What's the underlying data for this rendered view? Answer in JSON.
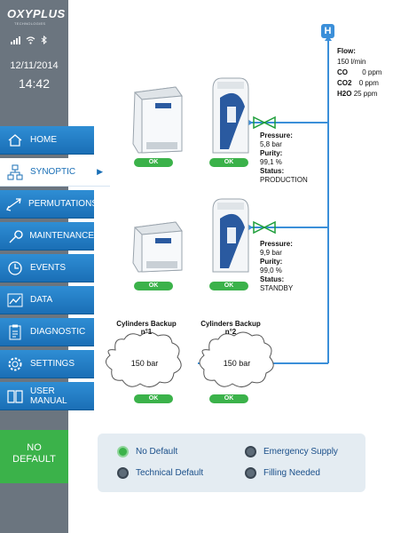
{
  "brand": {
    "name": "OXYPLUS",
    "subtitle": "TECHNOLOGIES"
  },
  "status": {
    "date": "12/11/2014",
    "time": "14:42"
  },
  "nav": [
    {
      "id": "home",
      "label": "HOME",
      "icon": "home-icon"
    },
    {
      "id": "synoptic",
      "label": "SYNOPTIC",
      "icon": "network-icon",
      "active": true
    },
    {
      "id": "permutations",
      "label": "PERMUTATIONS",
      "icon": "swap-arrows-icon"
    },
    {
      "id": "maintenance",
      "label": "MAINTENANCE",
      "icon": "wrench-icon"
    },
    {
      "id": "events",
      "label": "EVENTS",
      "icon": "history-clock-icon"
    },
    {
      "id": "data",
      "label": "DATA",
      "icon": "chart-icon"
    },
    {
      "id": "diagnostic",
      "label": "DIAGNOSTIC",
      "icon": "clipboard-icon"
    },
    {
      "id": "settings",
      "label": "SETTINGS",
      "icon": "gear-icon"
    },
    {
      "id": "user_manual",
      "label": "USER MANUAL",
      "icon": "book-icon"
    }
  ],
  "system_state": {
    "line1": "NO",
    "line2": "DEFAULT",
    "color": "#3bb24a"
  },
  "lines": [
    {
      "compressor_status": "OK",
      "generator_status": "OK",
      "pressure_label": "Pressure:",
      "pressure": "5,8 bar",
      "purity_label": "Purity:",
      "purity": "99,1 %",
      "status_label": "Status:",
      "status": "PRODUCTION"
    },
    {
      "compressor_status": "OK",
      "generator_status": "OK",
      "pressure_label": "Pressure:",
      "pressure": "9,9 bar",
      "purity_label": "Purity:",
      "purity": "99,0 %",
      "status_label": "Status:",
      "status": "STANDBY"
    }
  ],
  "cylinders": [
    {
      "title_line1": "Cylinders Backup",
      "title_line2": "n°1",
      "pressure": "150 bar",
      "status": "OK"
    },
    {
      "title_line1": "Cylinders Backup",
      "title_line2": "n°2",
      "pressure": "150 bar",
      "status": "OK"
    }
  ],
  "output": {
    "gas_symbol": "H",
    "flow_label": "Flow:",
    "flow_value": "150 l/min",
    "co_label": "CO",
    "co_value": "0 ppm",
    "co2_label": "CO2",
    "co2_value": "0 ppm",
    "h2o_label": "H2O",
    "h2o_value": "25 ppm"
  },
  "legend": [
    {
      "label": "No Default",
      "state": "on"
    },
    {
      "label": "Emergency Supply",
      "state": "off"
    },
    {
      "label": "Technical Default",
      "state": "off"
    },
    {
      "label": "Filling Needed",
      "state": "off"
    }
  ],
  "colors": {
    "accent": "#1a6fb6",
    "ok": "#3bb24a",
    "pipe": "#3b8fd9",
    "sidebar": "#6b757f"
  }
}
